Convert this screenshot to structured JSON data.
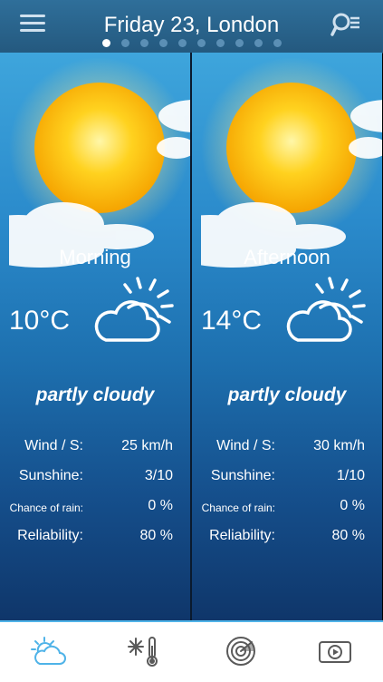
{
  "header": {
    "title": "Friday 23, London",
    "page_count": 10,
    "active_page": 0
  },
  "panels": [
    {
      "period": "Morning",
      "temperature": "10°C",
      "condition": "partly cloudy",
      "stats": [
        {
          "label": "Wind / S:",
          "value": "25 km/h"
        },
        {
          "label": "Sunshine:",
          "value": "3/10"
        },
        {
          "label": "Chance of rain:",
          "value": "0 %"
        },
        {
          "label": "Reliability:",
          "value": "80 %"
        }
      ]
    },
    {
      "period": "Afternoon",
      "temperature": "14°C",
      "condition": "partly cloudy",
      "stats": [
        {
          "label": "Wind / S:",
          "value": "30 km/h"
        },
        {
          "label": "Sunshine:",
          "value": "1/10"
        },
        {
          "label": "Chance of rain:",
          "value": "0 %"
        },
        {
          "label": "Reliability:",
          "value": "80 %"
        }
      ]
    }
  ],
  "tabs": [
    {
      "icon": "weather-partly-cloudy-icon",
      "active": true
    },
    {
      "icon": "snow-thermometer-icon",
      "active": false
    },
    {
      "icon": "radar-icon",
      "active": false
    },
    {
      "icon": "video-play-icon",
      "active": false
    }
  ],
  "colors": {
    "accent": "#4fb3e8",
    "header": "#2a6590",
    "tab_inactive": "#5a5a5a"
  }
}
